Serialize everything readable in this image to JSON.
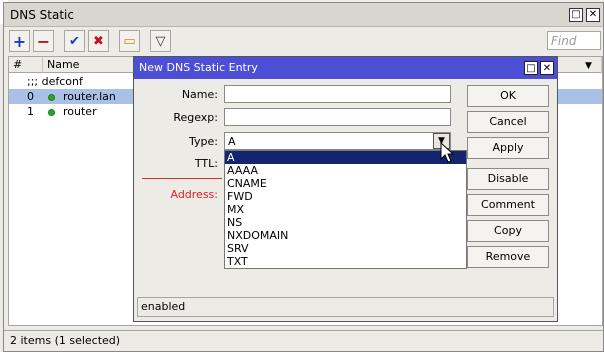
{
  "window": {
    "title": "DNS Static",
    "restore_glyph": "□",
    "close_glyph": "✕"
  },
  "toolbar": {
    "add": "+",
    "remove": "−",
    "enable": "✔",
    "disable": "✖",
    "comment": "▭",
    "filter": "▽",
    "find_placeholder": "Find"
  },
  "table": {
    "columns": [
      "#",
      "Name"
    ],
    "group": ";;; defconf",
    "rows": [
      {
        "num": "0",
        "name": "router.lan",
        "selected": true
      },
      {
        "num": "1",
        "name": "router",
        "selected": false
      }
    ]
  },
  "status": "2 items (1 selected)",
  "dialog": {
    "title": "New DNS Static Entry",
    "labels": {
      "name": "Name:",
      "regexp": "Regexp:",
      "type": "Type:",
      "ttl": "TTL:",
      "address": "Address:"
    },
    "values": {
      "name": "",
      "regexp": "",
      "type": "A"
    },
    "type_options": [
      "A",
      "AAAA",
      "CNAME",
      "FWD",
      "MX",
      "NS",
      "NXDOMAIN",
      "SRV",
      "TXT"
    ],
    "selected_option": "A",
    "buttons": {
      "ok": "OK",
      "cancel": "Cancel",
      "apply": "Apply",
      "disable": "Disable",
      "comment": "Comment",
      "copy": "Copy",
      "remove": "Remove"
    },
    "status": "enabled"
  },
  "colors": {
    "dialog_title": "#4d4ed6",
    "selected_option": "#14246e",
    "address_label": "#e02020",
    "running_dot": "#2fa52f"
  }
}
